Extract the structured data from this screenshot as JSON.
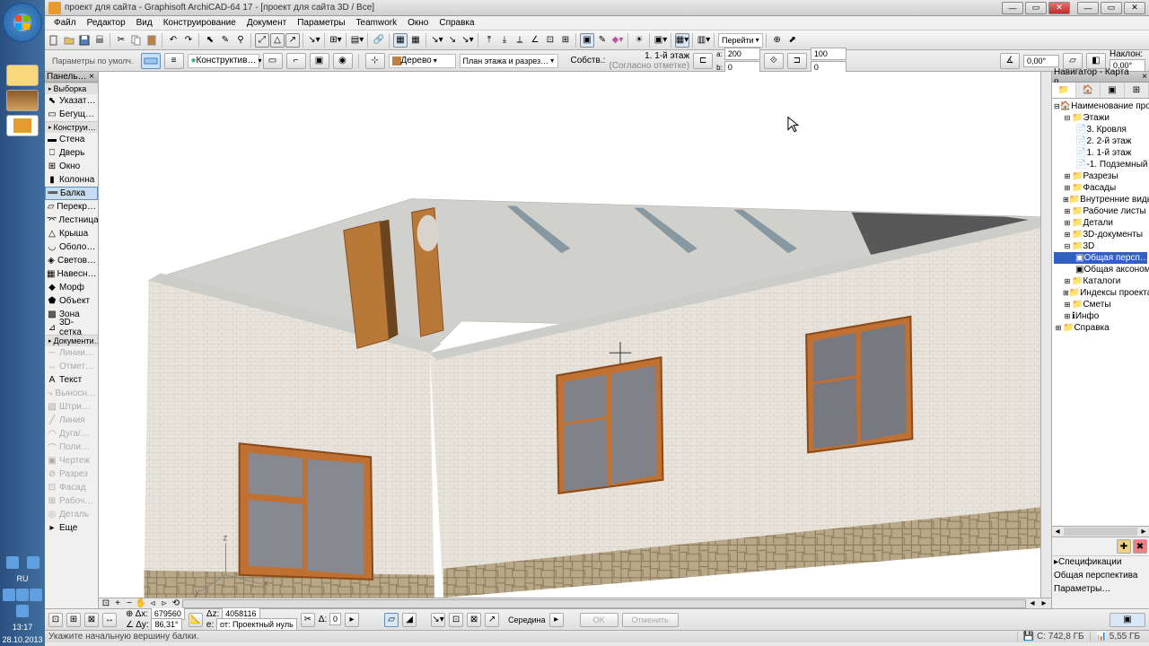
{
  "title": "проект для сайта - Graphisoft ArchiCAD-64 17 - [проект для сайта 3D / Все]",
  "menu": [
    "Файл",
    "Редактор",
    "Вид",
    "Конструирование",
    "Документ",
    "Параметры",
    "Teamwork",
    "Окно",
    "Справка"
  ],
  "toolbar2": {
    "goto": "Перейти"
  },
  "infobar": {
    "layer_label": "Параметры по умолч.",
    "construct": "Конструктив…",
    "material": "Дерево",
    "plan": "План этажа и разрез…",
    "own": "Собств.:",
    "floor": "1. 1-й этаж",
    "floor_sub": "(Согласно отметке)",
    "a": "200",
    "b": "0",
    "c": "100",
    "d": "0",
    "angle": "0,00°",
    "slope": "Наклон:",
    "slope_val": "0,00°"
  },
  "toolbox": {
    "header": "Панель…",
    "cat1": "Выборка",
    "items1": [
      "Указат…",
      "Бегущ…"
    ],
    "cat2": "Конструи…",
    "items2": [
      "Стена",
      "Дверь",
      "Окно",
      "Колонна",
      "Балка",
      "Перекр…",
      "Лестница",
      "Крыша",
      "Оболо…",
      "Светов…",
      "Навесн…",
      "Морф",
      "Объект",
      "Зона",
      "3D-сетка"
    ],
    "cat3": "Документи…",
    "items3": [
      "Линии…",
      "Отмет…",
      "Текст",
      "Выносн…",
      "Штри…",
      "Линия",
      "Дуга/…",
      "Поли…",
      "Чертеж",
      "Разрез",
      "Фасад",
      "Рабоч…",
      "Деталь"
    ],
    "more": "Еще"
  },
  "navigator": {
    "header": "Навигатор - Карта п…",
    "root": "Наименование проекта",
    "floors": "Этажи",
    "floor_items": [
      "3. Кровля",
      "2. 2-й этаж",
      "1. 1-й этаж",
      "-1. Подземный"
    ],
    "sections": "Разрезы",
    "facades": "Фасады",
    "interior": "Внутренние виды",
    "sheets": "Рабочие листы",
    "details": "Детали",
    "docs3d": "3D-документы",
    "view3d": "3D",
    "persp": "Общая персп…",
    "axon": "Общая аксоном…",
    "catalogs": "Каталоги",
    "indexes": "Индексы проекта",
    "estimates": "Сметы",
    "info": "Инфо",
    "help": "Справка",
    "spec": "Спецификации",
    "persp2": "Общая перспектива",
    "params": "Параметры…"
  },
  "status2": {
    "x_label": "Δx:",
    "x": "679560",
    "y_label": "Δy:",
    "y": "86,31°",
    "z_label": "Δz:",
    "z": "4058116",
    "zv": "e:",
    "zero": "от: Проектный нуль",
    "a_label": "Δ:",
    "a": "0",
    "mid": "Середина",
    "ok": "OK",
    "cancel": "Отменить"
  },
  "status": {
    "hint": "Укажите начальную вершину балки.",
    "disk": "C: 742,8 ГБ",
    "mem": "5,55 ГБ"
  },
  "taskbar": {
    "lang": "RU",
    "time": "13:17",
    "date": "28.10.2013"
  }
}
